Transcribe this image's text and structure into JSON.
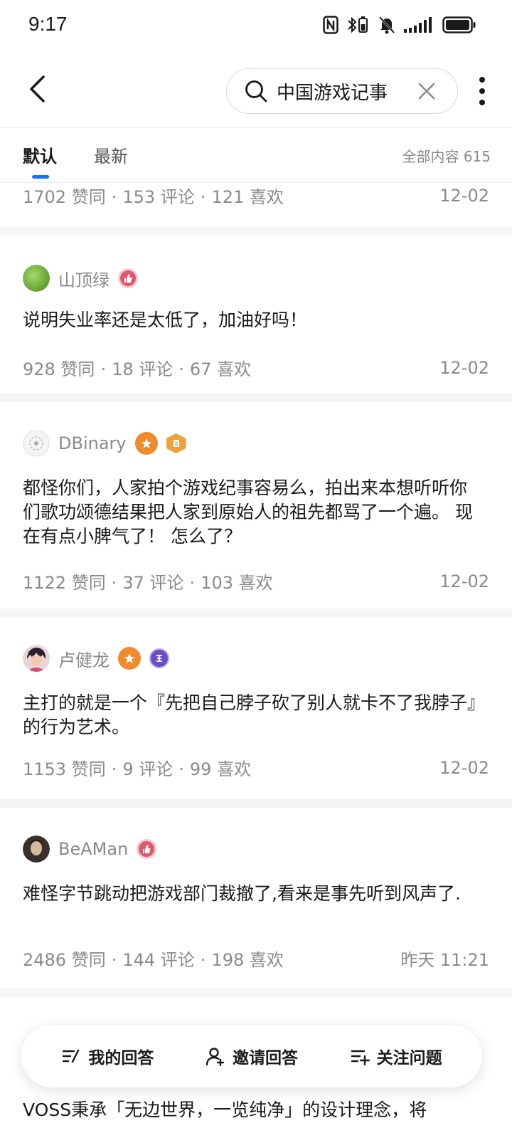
{
  "status_bar": {
    "time": "9:17"
  },
  "header": {
    "search_query": "中国游戏记事"
  },
  "tabs": {
    "default_label": "默认",
    "latest_label": "最新",
    "total_count": "全部内容 615"
  },
  "top_partial": {
    "stats": [
      "1702 赞同",
      "153 评论",
      "121 喜欢"
    ],
    "date": "12-02"
  },
  "answers": [
    {
      "author": "山顶绿",
      "content": "说明失业率还是太低了，加油好吗！",
      "stats": [
        "928 赞同",
        "18 评论",
        "67 喜欢"
      ],
      "date": "12-02"
    },
    {
      "author": "DBinary",
      "content": "都怪你们，人家拍个游戏纪事容易么，拍出来本想听听你们歌功颂德结果把人家到原始人的祖先都骂了一个遍。 现在有点小脾气了！ 怎么了？",
      "stats": [
        "1122 赞同",
        "37 评论",
        "103 喜欢"
      ],
      "date": "12-02"
    },
    {
      "author": "卢健龙",
      "content": "主打的就是一个『先把自己脖子砍了别人就卡不了我脖子』的行为艺术。",
      "stats": [
        "1153 赞同",
        "9 评论",
        "99 喜欢"
      ],
      "date": "12-02"
    },
    {
      "author": "BeAMan",
      "content": "难怪字节跳动把游戏部门裁撤了,看来是事先听到风声了.",
      "stats": [
        "2486 赞同",
        "144 评论",
        "198 喜欢"
      ],
      "date": "昨天 11:21"
    }
  ],
  "bottom_partial": {
    "content": "VOSS秉承「无边世界，一览纯净」的设计理念，将"
  },
  "bottom_bar": {
    "my_answer": "我的回答",
    "invite_answer": "邀请回答",
    "follow_question": "关注问题"
  },
  "colors": {
    "accent": "#1772f6",
    "muted_text": "#8a8a8a",
    "separator": "#f5f5f5"
  }
}
